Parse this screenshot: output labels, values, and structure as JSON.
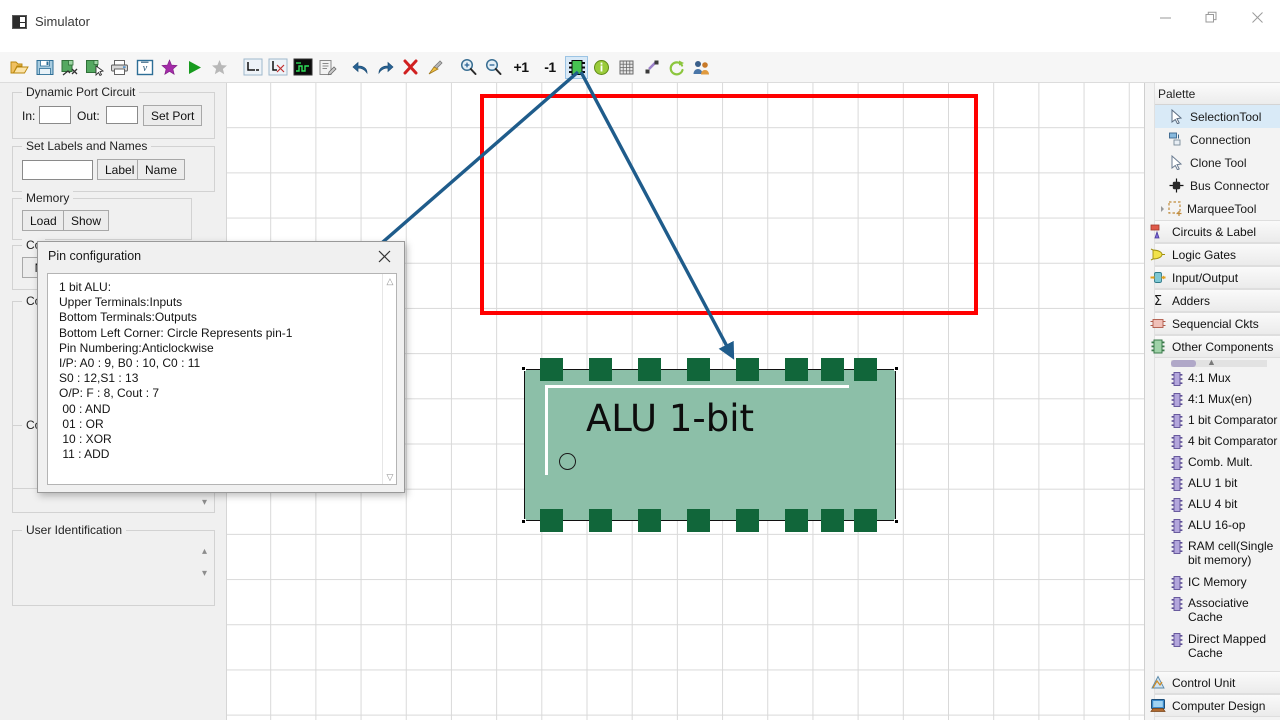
{
  "window": {
    "title": "Simulator",
    "app_icon": "simulator-icon",
    "controls": {
      "minimize": "minimize-icon",
      "restore": "restore-icon",
      "close": "close-icon"
    }
  },
  "toolbar": {
    "buttons": [
      {
        "name": "open-file",
        "icon": "folder-open-icon"
      },
      {
        "name": "save-file",
        "icon": "floppy-disk-icon"
      },
      {
        "name": "export-circuit",
        "icon": "export-icon"
      },
      {
        "name": "import-circuit",
        "icon": "import-icon"
      },
      {
        "name": "print",
        "icon": "printer-icon"
      },
      {
        "name": "verilog",
        "icon": "verilog-icon"
      },
      {
        "name": "favorite-add",
        "icon": "star-purple-icon"
      },
      {
        "name": "run-simulation",
        "icon": "play-green-icon"
      },
      {
        "name": "favorite-grey",
        "icon": "star-grey-icon"
      },
      {
        "name": "clock-low",
        "icon": "signal-low-icon"
      },
      {
        "name": "clock-edge",
        "icon": "signal-edge-icon"
      },
      {
        "name": "waveform",
        "icon": "waveform-icon"
      },
      {
        "name": "edit-notes",
        "icon": "notes-edit-icon"
      },
      {
        "name": "undo",
        "icon": "undo-arrow-icon"
      },
      {
        "name": "redo",
        "icon": "redo-arrow-icon"
      },
      {
        "name": "delete",
        "icon": "delete-x-icon"
      },
      {
        "name": "clear-all",
        "icon": "broom-icon"
      },
      {
        "name": "zoom-in",
        "icon": "magnifier-plus-icon"
      },
      {
        "name": "zoom-out",
        "icon": "magnifier-minus-icon"
      },
      {
        "name": "increment",
        "icon": "plus-one-label",
        "label": "+1"
      },
      {
        "name": "decrement",
        "icon": "minus-one-label",
        "label": "-1"
      },
      {
        "name": "ic-pin-configuration",
        "icon": "ic-chip-icon",
        "selected": true
      },
      {
        "name": "info",
        "icon": "info-circle-icon"
      },
      {
        "name": "grid-toggle",
        "icon": "grid-icon"
      },
      {
        "name": "wire-tool",
        "icon": "wire-diagonal-icon"
      },
      {
        "name": "refresh",
        "icon": "refresh-circular-icon"
      },
      {
        "name": "users",
        "icon": "users-icon"
      }
    ]
  },
  "left_panel": {
    "dynamic_port_circuit": {
      "title": "Dynamic Port Circuit",
      "in_label": "In:",
      "in_value": "",
      "out_label": "Out:",
      "out_value": "",
      "set_port_button": "Set Port"
    },
    "set_labels_and_names": {
      "title": "Set Labels and Names",
      "text_value": "",
      "label_button": "Label",
      "name_button": "Name"
    },
    "memory": {
      "title": "Memory",
      "load_button": "Load",
      "show_button": "Show"
    },
    "hidden_groups": [
      {
        "title": "Co",
        "button": "N"
      },
      {
        "title": "Co"
      },
      {
        "title": "Co"
      }
    ],
    "user_identification": {
      "title": "User Identification",
      "value": ""
    }
  },
  "dialog": {
    "title": "Pin configuration",
    "close_icon": "close-icon",
    "content": "1 bit ALU:\nUpper Terminals:Inputs\nBottom Terminals:Outputs\nBottom Left Corner: Circle Represents pin-1\nPin Numbering:Anticlockwise\nI/P: A0 : 9, B0 : 10, C0 : 11\nS0 : 12,S1 : 13\nO/P: F : 8, Cout : 7\n 00 : AND\n 01 : OR\n 10 : XOR\n 11 : ADD",
    "scroll_up_icon": "chevron-up-icon",
    "scroll_down_icon": "chevron-down-icon"
  },
  "canvas": {
    "component": {
      "label": "ALU 1-bit",
      "top_pins": 8,
      "bottom_pins": 8,
      "body_color": "#8cbfa8",
      "pin_color": "#11663a",
      "pin1_marker": "circle"
    },
    "highlight_color": "#ff0000",
    "annotation_arrow_color": "#1f5c8b",
    "arrows": [
      {
        "name": "arrow-to-dialog",
        "from": "ic-chip-toolbar-button",
        "to": "pin-configuration-dialog"
      },
      {
        "name": "arrow-to-component",
        "from": "ic-chip-toolbar-button",
        "to": "alu-component"
      }
    ]
  },
  "palette": {
    "header": "Palette",
    "tools": [
      {
        "label": "SelectionTool",
        "icon": "cursor-arrow-icon",
        "active": true
      },
      {
        "label": "Connection",
        "icon": "connection-icon",
        "active": false
      },
      {
        "label": "Clone Tool",
        "icon": "clone-cursor-icon",
        "active": false
      },
      {
        "label": "Bus Connector",
        "icon": "bus-connector-icon",
        "active": false
      },
      {
        "label": "MarqueeTool",
        "icon": "marquee-icon",
        "active": false
      }
    ],
    "categories": [
      {
        "label": "Circuits & Label",
        "icon": "circuits-label-icon"
      },
      {
        "label": "Logic Gates",
        "icon": "logic-gates-icon"
      },
      {
        "label": "Input/Output",
        "icon": "input-output-icon"
      },
      {
        "label": "Adders",
        "icon": "sigma-icon"
      },
      {
        "label": "Sequencial Ckts",
        "icon": "sequential-icon"
      },
      {
        "label": "Other Components",
        "icon": "chip-icon"
      }
    ],
    "other_components": [
      {
        "label": "4:1 Mux",
        "icon": "chip-icon"
      },
      {
        "label": "4:1 Mux(en)",
        "icon": "chip-icon"
      },
      {
        "label": "1 bit Comparator",
        "icon": "chip-icon"
      },
      {
        "label": "4 bit Comparator",
        "icon": "chip-icon"
      },
      {
        "label": "Comb. Mult.",
        "icon": "chip-icon"
      },
      {
        "label": "ALU 1 bit",
        "icon": "chip-icon"
      },
      {
        "label": "ALU 4 bit",
        "icon": "chip-icon"
      },
      {
        "label": "ALU 16-op",
        "icon": "chip-icon"
      },
      {
        "label": "RAM cell(Single bit memory)",
        "icon": "chip-icon"
      },
      {
        "label": "IC Memory",
        "icon": "chip-icon"
      },
      {
        "label": "Associative Cache",
        "icon": "chip-icon"
      },
      {
        "label": "Direct Mapped Cache",
        "icon": "chip-icon"
      }
    ],
    "bottom_categories": [
      {
        "label": "Control Unit",
        "icon": "control-unit-icon"
      },
      {
        "label": "Computer Design",
        "icon": "computer-design-icon"
      }
    ]
  }
}
